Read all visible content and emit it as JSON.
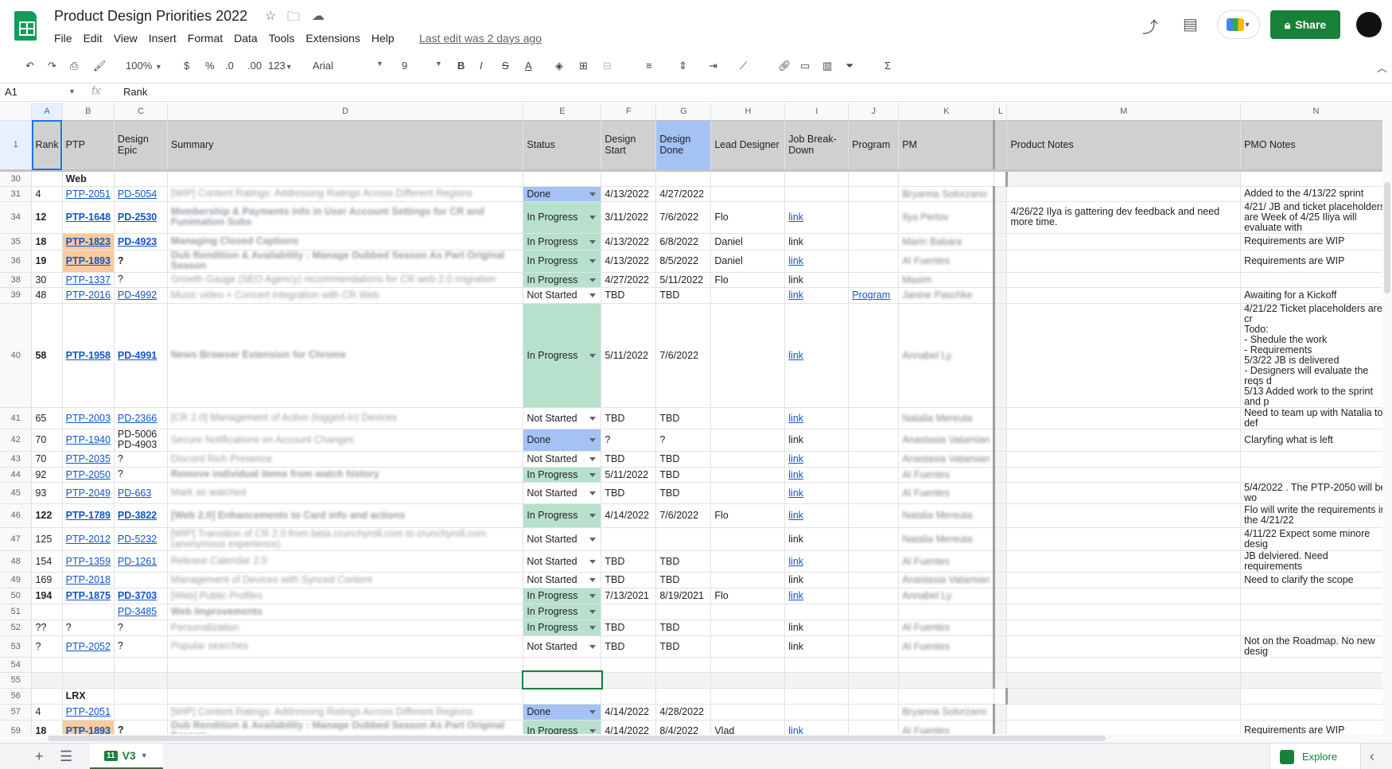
{
  "doc": {
    "title": "Product Design Priorities 2022",
    "last_edit": "Last edit was 2 days ago",
    "share": "Share"
  },
  "menu": [
    "File",
    "Edit",
    "View",
    "Insert",
    "Format",
    "Data",
    "Tools",
    "Extensions",
    "Help"
  ],
  "toolbar": {
    "zoom": "100%",
    "currency": "$",
    "percent": "%",
    "dec_less": ".0",
    "dec_more": ".00",
    "format": "123",
    "font": "Arial",
    "size": "9"
  },
  "formula": {
    "cell": "A1",
    "content": "Rank"
  },
  "columns": [
    "A",
    "B",
    "C",
    "D",
    "E",
    "F",
    "G",
    "H",
    "I",
    "J",
    "K",
    "L",
    "M",
    "N"
  ],
  "header_row": {
    "num": "1",
    "cells": [
      "Rank",
      "PTP",
      "Design Epic",
      "Summary",
      "Status",
      "Design Start",
      "Design Done",
      "Lead Designer",
      "Job Break-Down",
      "Program",
      "PM",
      "",
      "Product Notes",
      "PMO Notes"
    ]
  },
  "rows": [
    {
      "num": "30",
      "section": "Web"
    },
    {
      "num": "31",
      "rank": "4",
      "ptp": "PTP-2051",
      "epic": "PD-5054",
      "summary": "[WIP] Content Ratings: Addressing Ratings Across Different Regions",
      "status": "Done",
      "start": "4/13/2022",
      "done": "4/27/2022",
      "lead": "",
      "job": "",
      "program": "",
      "pm": "Bryanna Solorzano",
      "pnotes": "",
      "pmo": "Added to the 4/13/22 sprint"
    },
    {
      "num": "34",
      "rank": "12",
      "ptp": "PTP-1648",
      "epic": "PD-2530",
      "summary": "Membership & Payments info in User Account Settings for CR and Funimation Subs",
      "status": "In Progress",
      "start": "3/11/2022",
      "done": "7/6/2022",
      "lead": "Flo",
      "job": "link",
      "program": "",
      "pm": "Ilya Perlov",
      "pnotes": "4/26/22 Ilya is gattering dev feedback and need more time.",
      "pmo": "4/21/ JB and ticket placeholders are Week of 4/25 Iliya will evaluate with"
    },
    {
      "num": "35",
      "rank": "18",
      "ptp": "PTP-1823",
      "epic": "PD-4923",
      "summary": "Managing Closed Captions",
      "status": "In Progress",
      "start": "4/13/2022",
      "done": "6/8/2022",
      "lead": "Daniel",
      "job": "link",
      "program": "",
      "pm": "Marin Babara",
      "pnotes": "",
      "pmo": "Requirements are WIP"
    },
    {
      "num": "36",
      "rank": "19",
      "ptp": "PTP-1893",
      "epic": "?",
      "summary": "Dub Rendition & Availability : Manage Dubbed Season As Part Original Season",
      "status": "In Progress",
      "start": "4/13/2022",
      "done": "8/5/2022",
      "lead": "Daniel",
      "job": "link",
      "program": "",
      "pm": "Al Fuentes",
      "pnotes": "",
      "pmo": "Requirements are WIP"
    },
    {
      "num": "38",
      "rank": "30",
      "ptp": "PTP-1337",
      "epic": "?",
      "summary": "Growth Gauge (SEO Agency) recommendations for CR web 2.0 migration",
      "status": "In Progress",
      "start": "4/27/2022",
      "done": "5/11/2022",
      "lead": "Flo",
      "job": "link",
      "program": "",
      "pm": "Maxim",
      "pnotes": "",
      "pmo": ""
    },
    {
      "num": "39",
      "rank": "48",
      "ptp": "PTP-2016",
      "epic": "PD-4992",
      "summary": "Music video + Concert integration with CR Web",
      "status": "Not Started",
      "start": "TBD",
      "done": "TBD",
      "lead": "",
      "job": "link",
      "program": "Program",
      "pm": "Janine Paschke",
      "pnotes": "",
      "pmo": "Awaiting for a Kickoff"
    },
    {
      "num": "40",
      "rank": "58",
      "ptp": "PTP-1958",
      "epic": "PD-4991",
      "summary": "News Browser Extension for Chrome",
      "status": "In Progress",
      "start": "5/11/2022",
      "done": "7/6/2022",
      "lead": "",
      "job": "link",
      "program": "",
      "pm": "Annabel Ly",
      "pnotes": "",
      "pmo": "4/21/22 Ticket placeholders are cr\nTodo:\n- Shedule the work\n- Requirements\n5/3/22 JB is delivered\n- Designers will evaluate the reqs d\n5/13 Added work to the sprint and p"
    },
    {
      "num": "41",
      "rank": "65",
      "ptp": "PTP-2003",
      "epic": "PD-2366",
      "summary": "[CR 2.0] Management of Active (logged-in) Devices",
      "status": "Not Started",
      "start": "TBD",
      "done": "TBD",
      "lead": "",
      "job": "link",
      "program": "",
      "pm": "Natalia Mereuta",
      "pnotes": "",
      "pmo": "Need to team up with Natalia to def"
    },
    {
      "num": "42",
      "rank": "70",
      "ptp": "PTP-1940",
      "epic": "PD-5006\nPD-4903",
      "summary": "Secure Notifications on Account Changes",
      "status": "Done",
      "start": "?",
      "done": "?",
      "lead": "",
      "job": "link",
      "program": "",
      "pm": "Anastasia Vatamian",
      "pnotes": "",
      "pmo": "Claryfing what is left"
    },
    {
      "num": "43",
      "rank": "70",
      "ptp": "PTP-2035",
      "epic": "?",
      "summary": "Discord Rich Presence",
      "status": "Not Started",
      "start": "TBD",
      "done": "TBD",
      "lead": "",
      "job": "link",
      "program": "",
      "pm": "Anastasia Vatamian",
      "pnotes": "",
      "pmo": ""
    },
    {
      "num": "44",
      "rank": "92",
      "ptp": "PTP-2050",
      "epic": "?",
      "summary": "Remove individual items from watch history",
      "status": "In Progress",
      "start": "5/11/2022",
      "done": "TBD",
      "lead": "",
      "job": "link",
      "program": "",
      "pm": "Al Fuentes",
      "pnotes": "",
      "pmo": ""
    },
    {
      "num": "45",
      "rank": "93",
      "ptp": "PTP-2049",
      "epic": "PD-663",
      "summary": "Mark as watched",
      "status": "Not Started",
      "start": "TBD",
      "done": "TBD",
      "lead": "",
      "job": "link",
      "program": "",
      "pm": "Al Fuentes",
      "pnotes": "",
      "pmo": "5/4/2022 . The PTP-2050 will be wo"
    },
    {
      "num": "46",
      "rank": "122",
      "ptp": "PTP-1789",
      "epic": "PD-3822",
      "summary": "[Web 2.0] Enhancements to Card info and actions",
      "status": "In Progress",
      "start": "4/14/2022",
      "done": "7/6/2022",
      "lead": "Flo",
      "job": "link",
      "program": "",
      "pm": "Natalia Mereuta",
      "pnotes": "",
      "pmo": "Flo will write the requirements in the 4/21/22"
    },
    {
      "num": "47",
      "rank": "125",
      "ptp": "PTP-2012",
      "epic": "PD-5232",
      "summary": "[WIP] Transition of CR 2.0 from beta.crunchyroll.com to crunchyroll.com (anonymous experience)",
      "status": "Not Started",
      "start": "",
      "done": "",
      "lead": "",
      "job": "link",
      "program": "",
      "pm": "Natalia Mereuta",
      "pnotes": "",
      "pmo": "4/11/22 Expect some minore desig"
    },
    {
      "num": "48",
      "rank": "154",
      "ptp": "PTP-1359",
      "epic": "PD-1261",
      "summary": "Release Calendar 2.0",
      "status": "Not Started",
      "start": "TBD",
      "done": "TBD",
      "lead": "",
      "job": "link",
      "program": "",
      "pm": "Al Fuentes",
      "pnotes": "",
      "pmo": "JB delviered. Need requirements"
    },
    {
      "num": "49",
      "rank": "169",
      "ptp": "PTP-2018",
      "epic": "",
      "summary": "Management of Devices with Synced Content",
      "status": "Not Started",
      "start": "TBD",
      "done": "TBD",
      "lead": "",
      "job": "link",
      "program": "",
      "pm": "Anastasia Vatamian",
      "pnotes": "",
      "pmo": "Need to clarify the scope"
    },
    {
      "num": "50",
      "rank": "194",
      "ptp": "PTP-1875",
      "epic": "PD-3703",
      "summary": "[Web] Public Profiles",
      "status": "In Progress",
      "start": "7/13/2021",
      "done": "8/19/2021",
      "lead": "Flo",
      "job": "link",
      "program": "",
      "pm": "Annabel Ly",
      "pnotes": "",
      "pmo": ""
    },
    {
      "num": "51",
      "rank": "",
      "ptp": "",
      "epic": "PD-3485",
      "summary": "Web Improvements",
      "status": "In Progress",
      "start": "",
      "done": "",
      "lead": "",
      "job": "",
      "program": "",
      "pm": "",
      "pnotes": "",
      "pmo": ""
    },
    {
      "num": "52",
      "rank": "??",
      "ptp": "?",
      "epic": "?",
      "summary": "Personalization",
      "status": "In Progress",
      "start": "TBD",
      "done": "TBD",
      "lead": "",
      "job": "link",
      "program": "",
      "pm": "Al Fuentes",
      "pnotes": "",
      "pmo": ""
    },
    {
      "num": "53",
      "rank": "?",
      "ptp": "PTP-2052",
      "epic": "?",
      "summary": "Popular searches",
      "status": "Not Started",
      "start": "TBD",
      "done": "TBD",
      "lead": "",
      "job": "link",
      "program": "",
      "pm": "Al Fuentes",
      "pnotes": "",
      "pmo": "Not on the Roadmap. No new desig"
    },
    {
      "num": "54",
      "empty": true
    },
    {
      "num": "55",
      "empty": true
    },
    {
      "num": "56",
      "section": "LRX"
    },
    {
      "num": "57",
      "rank": "4",
      "ptp": "PTP-2051",
      "epic": "",
      "summary": "[WIP] Content Ratings: Addressing Ratings Across Different Regions",
      "status": "Done",
      "start": "4/14/2022",
      "done": "4/28/2022",
      "lead": "",
      "job": "",
      "program": "",
      "pm": "Bryanna Solorzano",
      "pnotes": "",
      "pmo": ""
    },
    {
      "num": "59",
      "rank": "18",
      "ptp": "PTP-1893",
      "epic": "?",
      "summary": "Dub Rendition & Availability : Manage Dubbed Season As Part Original Season",
      "status": "In Progress",
      "start": "4/14/2022",
      "done": "8/4/2022",
      "lead": "Vlad",
      "job": "link",
      "program": "",
      "pm": "Al Fuentes",
      "pnotes": "",
      "pmo": "Requirements are WIP"
    }
  ],
  "sheet": {
    "tab": "V3",
    "tab_count": "11",
    "explore": "Explore"
  }
}
